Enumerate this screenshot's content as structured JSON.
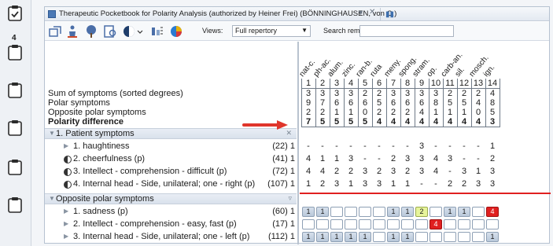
{
  "window": {
    "title": "Therapeutic Pocketbook for Polarity Analysis (authorized by Heiner Frei) (BÖNNINGHAUSEN, von C.)"
  },
  "left_rail": {
    "badge": "4"
  },
  "toolbar": {
    "views_label": "Views:",
    "views_value": "Full repertory",
    "search_label": "Search remedy:",
    "search_value": ""
  },
  "summary": {
    "sum_label": "Sum of symptoms (sorted degrees)",
    "polar_label": "Polar symptoms",
    "opposite_label": "Opposite polar symptoms",
    "difference_label": "Polarity difference"
  },
  "sections": {
    "patient": "1. Patient symptoms",
    "opposite": "Opposite polar symptoms"
  },
  "patient_symptoms": [
    {
      "icon": "triangle",
      "text": "1. haughtiness",
      "count": "(22) 1"
    },
    {
      "icon": "half-circle",
      "text": "2. cheerfulness (p)",
      "count": "(41) 1"
    },
    {
      "icon": "half-circle",
      "text": "3. Intellect - comprehension - difficult (p)",
      "count": "(72) 1"
    },
    {
      "icon": "half-circle",
      "text": "4. Internal head - Side, unilateral; one - right (p)",
      "count": "(107) 1"
    }
  ],
  "opposite_symptoms": [
    {
      "icon": "triangle",
      "text": "1. sadness (p)",
      "count": "(60) 1"
    },
    {
      "icon": "triangle",
      "text": "2. Intellect - comprehension - easy, fast (p)",
      "count": "(17) 1"
    },
    {
      "icon": "triangle",
      "text": "3. Internal head - Side, unilateral; one - left (p)",
      "count": "(112) 1"
    }
  ],
  "remedies": [
    "nat-c.",
    "ph-ac.",
    "alum.",
    "zinc.",
    "ran-b.",
    "ruta",
    "meny.",
    "spong.",
    "stram.",
    "op.",
    "carb-an.",
    "sil.",
    "mosch.",
    "ign."
  ],
  "col_numbers": [
    "1",
    "2",
    "3",
    "4",
    "5",
    "6",
    "7",
    "8",
    "9",
    "10",
    "11",
    "12",
    "13",
    "14"
  ],
  "grid": {
    "sum": [
      "3",
      "3",
      "3",
      "3",
      "2",
      "2",
      "3",
      "3",
      "3",
      "3",
      "2",
      "2",
      "2",
      "4"
    ],
    "polar": [
      "9",
      "7",
      "6",
      "6",
      "6",
      "5",
      "6",
      "6",
      "6",
      "8",
      "5",
      "5",
      "4",
      "8"
    ],
    "opposite": [
      "2",
      "2",
      "1",
      "1",
      "0",
      "2",
      "2",
      "2",
      "4",
      "1",
      "1",
      "1",
      "0",
      "5"
    ],
    "diff": [
      "7",
      "5",
      "5",
      "5",
      "5",
      "4",
      "4",
      "4",
      "4",
      "4",
      "4",
      "4",
      "4",
      "3"
    ]
  },
  "patient_grid": [
    [
      "-",
      "-",
      "-",
      "-",
      "-",
      "-",
      "-",
      "-",
      "3",
      "-",
      "-",
      "-",
      "-",
      "1"
    ],
    [
      "4",
      "1",
      "1",
      "3",
      "-",
      "-",
      "2",
      "3",
      "3",
      "4",
      "3",
      "-",
      "-",
      "2"
    ],
    [
      "4",
      "4",
      "2",
      "2",
      "3",
      "2",
      "3",
      "2",
      "3",
      "4",
      "-",
      "3",
      "1",
      "3"
    ],
    [
      "1",
      "2",
      "3",
      "1",
      "3",
      "3",
      "1",
      "1",
      "-",
      "-",
      "2",
      "2",
      "3",
      "3"
    ]
  ],
  "opposite_grid": [
    [
      "1",
      "1",
      "",
      "",
      "",
      "",
      "1",
      "1",
      "2",
      "",
      "1",
      "1",
      "",
      "4"
    ],
    [
      "",
      "",
      "",
      "",
      "",
      "",
      "",
      "",
      "",
      "4",
      "",
      "",
      "",
      ""
    ],
    [
      "1",
      "1",
      "1",
      "1",
      "1",
      "",
      "1",
      "1",
      "",
      "",
      "",
      "",
      "",
      "1"
    ]
  ],
  "colors": {
    "accent_red": "#e02020",
    "highlight_yellow": "#e7f49a",
    "box_blue": "#b9c8da"
  }
}
